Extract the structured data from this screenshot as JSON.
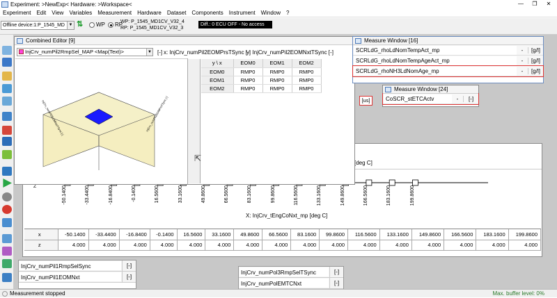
{
  "window": {
    "title": "Experiment: >NewExp< Hardware: >Workspace<",
    "min": "—",
    "max": "❐",
    "close": "✕"
  },
  "menu": [
    "Experiment",
    "Edit",
    "View",
    "Variables",
    "Measurement",
    "Hardware",
    "Dataset",
    "Components",
    "Instrument",
    "Window",
    "?"
  ],
  "toolbar": {
    "device_combo": "Offline device:1:P_1545_MD",
    "wp_label": "WP",
    "rp_label": "RP",
    "wp_value": "WP: P_1545_MD1CV_V32_4",
    "rp_value": "RP: P_1545_MD1CV_V32_3",
    "status": "Diff.: 0    ECU OFF - No access"
  },
  "combined_editor": {
    "title": "Combined Editor [9]",
    "map_combo": "InjCrv_numPil2RmpSel_MAP <Map(Text)>",
    "unit_bracket": "[-]",
    "x_label": "x:  InjCrv_numPil2EOMPrsTSync [-]",
    "y_label": "y:  InjCrv_numPil2EOMNxtTSync [-]",
    "axis_header": "y \\ x",
    "col_headers": [
      "EOM0",
      "EOM1",
      "EOM2"
    ],
    "rows": [
      {
        "label": "EOM0",
        "cells": [
          "RMP0",
          "RMP0",
          "RMP0"
        ]
      },
      {
        "label": "EOM1",
        "cells": [
          "RMP0",
          "RMP0",
          "RMP0"
        ]
      },
      {
        "label": "EOM2",
        "cells": [
          "RMP0",
          "RMP0",
          "RMP0"
        ]
      }
    ]
  },
  "measure16": {
    "title": "Measure Window [16]",
    "rows": [
      {
        "name": "SCRLdG_rhoLdNomTempAct_mp",
        "value": "-",
        "unit": "[g/l]"
      },
      {
        "name": "SCRLdG_rhoLdNomTempAgeAct_mp",
        "value": "-",
        "unit": "[g/l]"
      },
      {
        "name": "SCRLdG_rhoNH3LdNomAge_mp",
        "value": "-",
        "unit": "[g/l]"
      }
    ]
  },
  "measure24": {
    "title": "Measure Window [24]",
    "rows": [
      {
        "name": "CoSCR_stETCActv",
        "value": "-",
        "unit": "[-]"
      }
    ]
  },
  "us_unit": "[us]",
  "curve": {
    "header_unit": "[deg C]",
    "x_axis_title": "X: InjCrv_tEngCoNxt_mp [deg C]",
    "x_ticks": [
      "-50.1400",
      "-33.4400",
      "-16.8400",
      "-0.1400",
      "16.5600",
      "33.1600",
      "49.8600",
      "66.5600",
      "83.1600",
      "99.8600",
      "116.5600",
      "133.1600",
      "149.8600",
      "166.5600",
      "183.1600",
      "199.8600"
    ],
    "row_x_label": "x",
    "row_z_label": "z",
    "x_values": [
      "-50.1400",
      "-33.4400",
      "-16.8400",
      "-0.1400",
      "16.5600",
      "33.1600",
      "49.8600",
      "66.5600",
      "83.1600",
      "99.8600",
      "116.5600",
      "133.1600",
      "149.8600",
      "166.5600",
      "183.1600",
      "199.8600"
    ],
    "z_values": [
      "4.000",
      "4.000",
      "4.000",
      "4.000",
      "4.000",
      "4.000",
      "4.000",
      "4.000",
      "4.000",
      "4.000",
      "4.000",
      "4.000",
      "4.000",
      "4.000",
      "4.000",
      "4.000"
    ],
    "z_axis_label": "Z"
  },
  "bottom_vars": {
    "left": [
      {
        "name": "InjCrv_numPil1RmpSelSync",
        "unit": "[-]"
      },
      {
        "name": "InjCrv_numPil1EOMNxt",
        "unit": "[-]"
      }
    ],
    "right": [
      {
        "name": "InjCrv_numPol3RmpSelTSync",
        "unit": "[-]"
      },
      {
        "name": "InjCrv_numPolEMTCNxt",
        "unit": "[-]"
      }
    ]
  },
  "status": {
    "left": "Measurement stopped",
    "right": "Max. buffer level: 0%"
  },
  "plot3d_axis_labels": [
    "InjCrv_numPil2EOMNxtTSync [-]",
    "InjCrv_numPil2EOMPrsTSync [-]"
  ]
}
